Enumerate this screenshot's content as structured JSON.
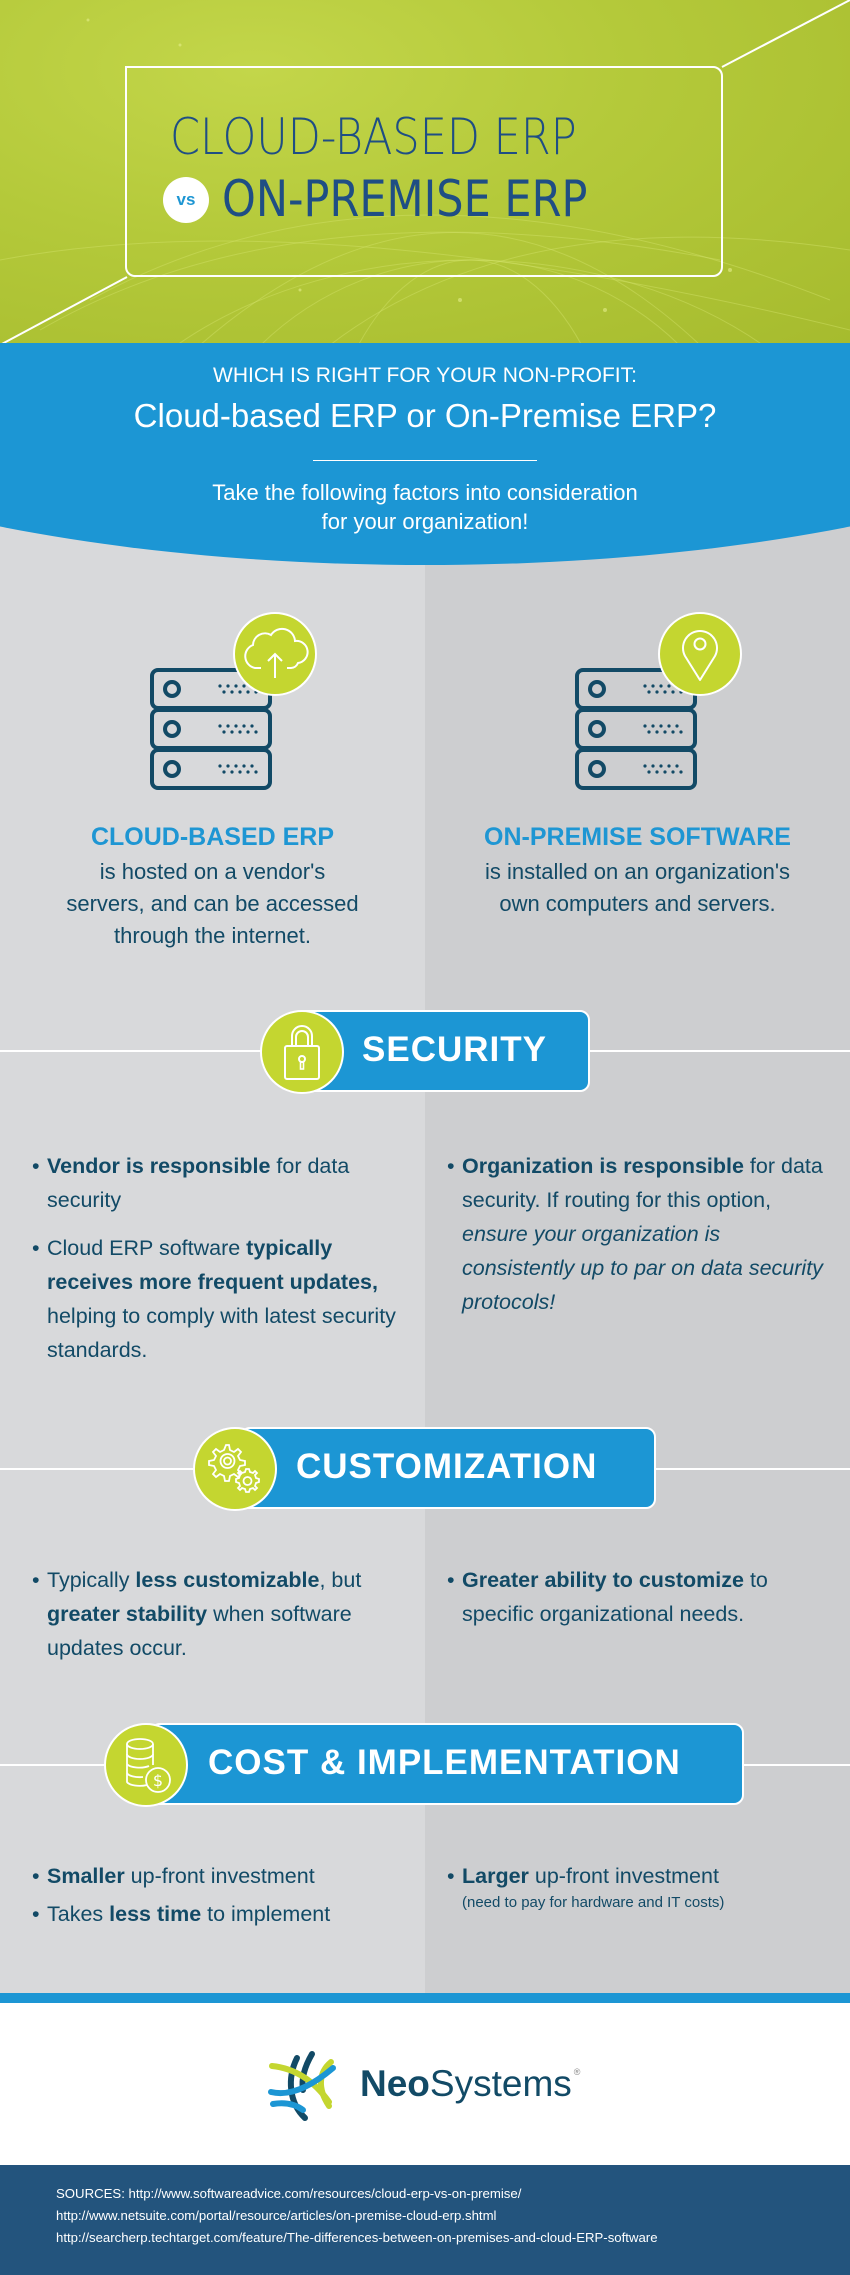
{
  "hero": {
    "title_line1": "CLOUD-BASED ERP",
    "vs_label": "vs",
    "title_line2": "ON-PREMISE ERP"
  },
  "intro": {
    "kicker": "WHICH IS RIGHT FOR YOUR NON-PROFIT:",
    "question": "Cloud-based ERP or On-Premise ERP?",
    "subtitle_line1": "Take the following factors into consideration",
    "subtitle_line2": "for your organization!"
  },
  "definitions": {
    "cloud": {
      "icon": "cloud-upload-icon",
      "title": "CLOUD-BASED ERP",
      "body_lines": [
        "is hosted on a vendor's",
        "servers, and can be accessed",
        "through the internet."
      ]
    },
    "onpremise": {
      "icon": "location-pin-icon",
      "title": "ON-PREMISE SOFTWARE",
      "body_lines": [
        "is installed on an organization's",
        "own computers and servers."
      ]
    }
  },
  "sections": {
    "security": {
      "icon": "padlock-icon",
      "label": "SECURITY",
      "cloud": [
        {
          "bold": "Vendor is responsible",
          "rest": " for data security"
        },
        {
          "pre": "Cloud ERP software ",
          "bold": "typically receives more frequent updates,",
          "rest": " helping to comply with latest security standards."
        }
      ],
      "onpremise": [
        {
          "bold": "Organization is responsible",
          "rest": " for data security. If routing for this option, ",
          "italic": "ensure your organization is consistently up to par on data security protocols!"
        }
      ]
    },
    "customization": {
      "icon": "gears-icon",
      "label": "CUSTOMIZATION",
      "cloud": [
        {
          "pre": "Typically ",
          "bold": "less customizable",
          "mid": ", but ",
          "bold2": "greater stability",
          "rest": " when software updates occur."
        }
      ],
      "onpremise": [
        {
          "bold": "Greater ability to customize",
          "rest": " to specific organizational needs."
        }
      ]
    },
    "cost": {
      "icon": "coins-dollar-icon",
      "label": "COST & IMPLEMENTATION",
      "cloud": [
        {
          "bold": "Smaller",
          "rest": " up-front investment"
        },
        {
          "pre": "Takes ",
          "bold": "less time",
          "rest": " to implement"
        }
      ],
      "onpremise": [
        {
          "bold": "Larger",
          "rest": " up-front investment",
          "note": "(need to pay for hardware and IT costs)"
        }
      ]
    }
  },
  "bullet_char": "•",
  "footer": {
    "logo_bold": "Neo",
    "logo_light": "Systems",
    "logo_reg": "®",
    "sources": [
      "SOURCES: http://www.softwareadvice.com/resources/cloud-erp-vs-on-premise/",
      "http://www.netsuite.com/portal/resource/articles/on-premise-cloud-erp.shtml",
      "http://searcherp.techtarget.com/feature/The-differences-between-on-premises-and-cloud-ERP-software"
    ]
  },
  "colors": {
    "lime": "#c4d630",
    "blue": "#1c96d4",
    "navy": "#124a66",
    "title_blue": "#1f4e84",
    "sources_bg": "#23547d"
  }
}
